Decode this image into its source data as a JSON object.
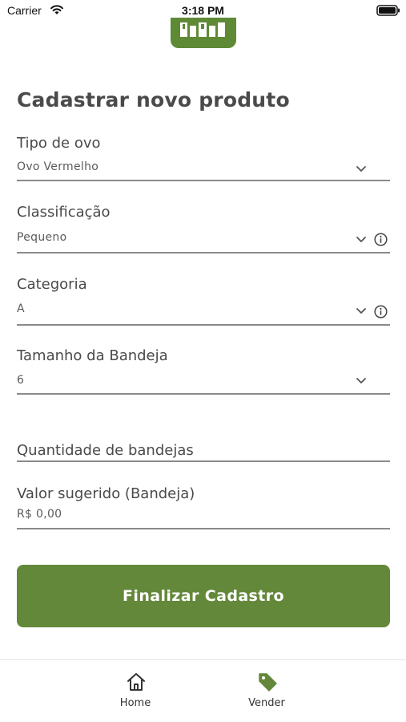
{
  "status_bar": {
    "carrier": "Carrier",
    "time": "3:18 PM"
  },
  "page": {
    "title": "Cadastrar novo produto"
  },
  "form": {
    "egg_type": {
      "label": "Tipo de ovo",
      "value": "Ovo Vermelho"
    },
    "classification": {
      "label": "Classificação",
      "value": "Pequeno"
    },
    "category": {
      "label": "Categoria",
      "value": "A"
    },
    "tray_size": {
      "label": "Tamanho da Bandeja",
      "value": "6"
    },
    "tray_quantity": {
      "placeholder": "Quantidade de bandejas",
      "value": ""
    },
    "suggested_price": {
      "label": "Valor sugerido (Bandeja)",
      "value": "R$ 0,00"
    }
  },
  "submit_label": "Finalizar Cadastro",
  "tab_bar": {
    "items": [
      {
        "label": "Home",
        "icon": "home-icon"
      },
      {
        "label": "Vender",
        "icon": "tag-icon",
        "active": true
      }
    ]
  },
  "colors": {
    "brand_green": "#64883a",
    "text": "#4a4a4a",
    "line": "#8a8a8a"
  }
}
